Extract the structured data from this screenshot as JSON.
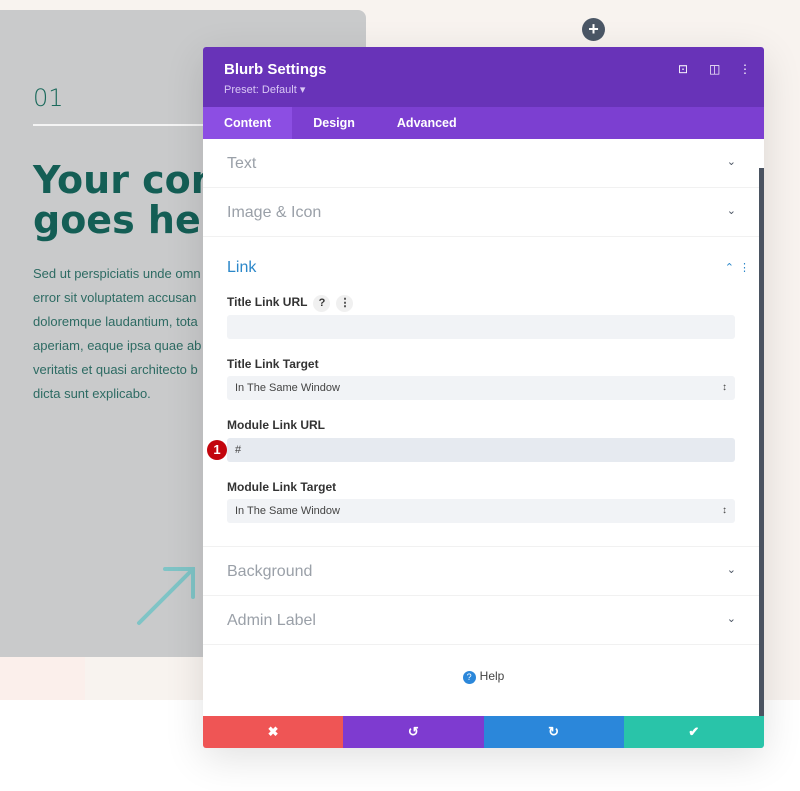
{
  "page": {
    "number": "01",
    "heading": "Your cont\ngoes here",
    "body": "Sed ut perspiciatis unde omn\nerror sit voluptatem accusan\ndoloremque laudantium, tota\naperiam, eaque ipsa quae ab\nveritatis et quasi architecto b\ndicta sunt explicabo.",
    "add_icon": "+"
  },
  "modal": {
    "title": "Blurb Settings",
    "preset": "Preset: Default ▾",
    "tabs": [
      "Content",
      "Design",
      "Advanced"
    ],
    "sections": {
      "text": "Text",
      "image": "Image & Icon",
      "link": "Link",
      "background": "Background",
      "admin": "Admin Label"
    },
    "fields": {
      "title_url_label": "Title Link URL",
      "title_url_value": "",
      "title_target_label": "Title Link Target",
      "title_target_value": "In The Same Window",
      "module_url_label": "Module Link URL",
      "module_url_value": "#",
      "module_target_label": "Module Link Target",
      "module_target_value": "In The Same Window"
    },
    "step_badge": "1",
    "help": "Help",
    "colors": {
      "header": "#6833b8",
      "tabs": "#7c3fd1",
      "cancel": "#ef5555",
      "undo": "#7e3bd0",
      "redo": "#2b87da",
      "save": "#29c4a9"
    }
  }
}
